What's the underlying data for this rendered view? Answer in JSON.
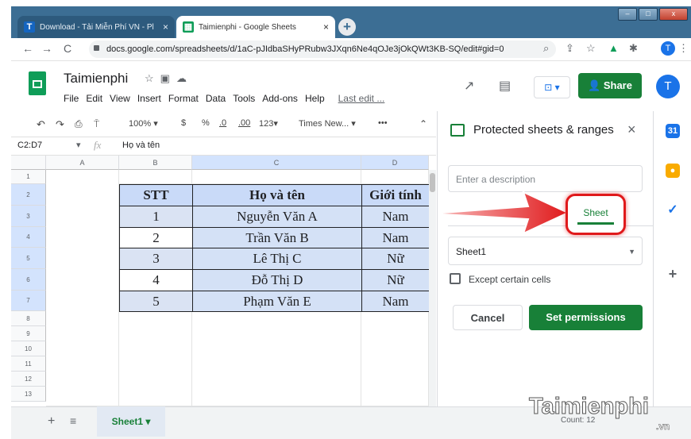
{
  "browser": {
    "tabs": [
      {
        "label": "Download - Tải Miễn Phí VN - Pl",
        "close": "×"
      },
      {
        "label": "Taimienphi - Google Sheets",
        "close": "×"
      }
    ],
    "new_tab": "+",
    "url": "docs.google.com/spreadsheets/d/1aC-pJIdbaSHyPRubw3JXqn6Ne4qOJe3jOkQWt3KB-SQ/edit#gid=0",
    "profile_initial": "T"
  },
  "sheets": {
    "title": "Taimienphi",
    "menu": [
      "File",
      "Edit",
      "View",
      "Insert",
      "Format",
      "Data",
      "Tools",
      "Add-ons",
      "Help"
    ],
    "last_edit": "Last edit ...",
    "share_label": "Share",
    "avatar_initial": "T",
    "toolbar": {
      "zoom": "100%",
      "currency": "$",
      "percent": "%",
      "dec_less": ".0",
      "dec_more": ".00",
      "format_more": "123",
      "font": "Times New...",
      "more": "•••"
    },
    "name_box": "C2:D7",
    "fx": "fx",
    "formula_value": "Họ và tên",
    "columns": [
      "A",
      "B",
      "C",
      "D"
    ],
    "rows": [
      "1",
      "2",
      "3",
      "4",
      "5",
      "6",
      "7",
      "8",
      "9",
      "10",
      "11",
      "12",
      "13"
    ],
    "table": {
      "headers": [
        "STT",
        "Họ và tên",
        "Giới tính"
      ],
      "rows": [
        [
          "1",
          "Nguyễn Văn A",
          "Nam"
        ],
        [
          "2",
          "Trần Văn B",
          "Nam"
        ],
        [
          "3",
          "Lê Thị C",
          "Nữ"
        ],
        [
          "4",
          "Đỗ Thị D",
          "Nữ"
        ],
        [
          "5",
          "Phạm Văn E",
          "Nam"
        ]
      ]
    },
    "sheet_tab": "Sheet1",
    "count": "Count: 12"
  },
  "panel": {
    "title": "Protected sheets & ranges",
    "close": "×",
    "description_placeholder": "Enter a description",
    "tab_sheet": "Sheet",
    "sheet_select": "Sheet1",
    "except_label": "Except certain cells",
    "cancel_label": "Cancel",
    "set_label": "Set permissions"
  },
  "watermark": {
    "brand": "Taimienphi",
    "suffix": ".vn"
  },
  "colors": {
    "green": "#188038",
    "blue": "#1a73e8",
    "highlight_red": "#e0191b"
  }
}
